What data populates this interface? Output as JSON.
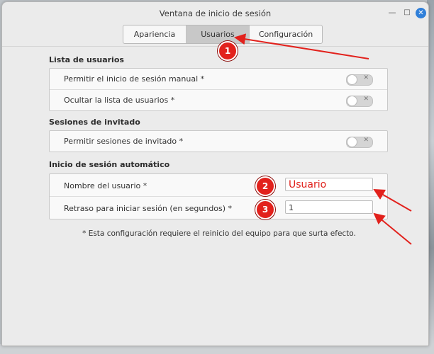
{
  "window": {
    "title": "Ventana de inicio de sesión"
  },
  "tabs": [
    "Apariencia",
    "Usuarios",
    "Configuración"
  ],
  "sections": {
    "users_list": {
      "title": "Lista de usuarios",
      "rows": [
        "Permitir el inicio de sesión manual *",
        "Ocultar la lista de usuarios *"
      ]
    },
    "guest": {
      "title": "Sesiones de invitado",
      "rows": [
        "Permitir sesiones de invitado *"
      ]
    },
    "autologin": {
      "title": "Inicio de sesión automático",
      "user_label": "Nombre del usuario *",
      "user_value": "Usuario",
      "delay_label": "Retraso para iniciar sesión (en segundos) *",
      "delay_value": "1"
    }
  },
  "note": "* Esta configuración requiere el reinicio del equipo para que surta efecto.",
  "annotations": [
    "1",
    "2",
    "3"
  ],
  "switch_icon": "x-mark-icon",
  "colors": {
    "annotation_red": "#e2211c",
    "close_button": "#2f7fd9"
  }
}
